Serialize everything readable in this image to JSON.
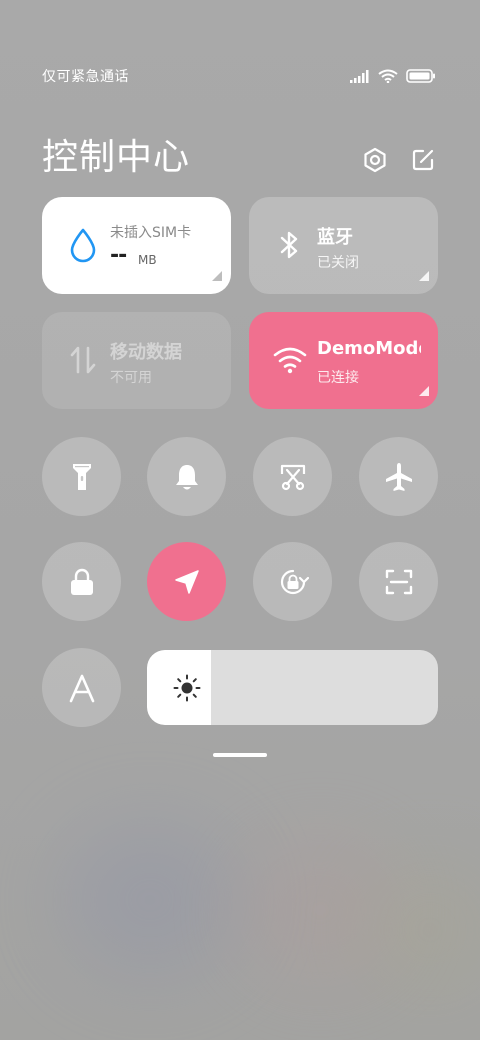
{
  "status_bar": {
    "carrier_text": "仅可紧急通话",
    "icons": [
      "signal-icon",
      "wifi-icon",
      "battery-icon"
    ]
  },
  "header": {
    "title": "控制中心",
    "icons": [
      "settings-icon",
      "edit-icon"
    ]
  },
  "tiles": {
    "data_usage": {
      "label": "未插入SIM卡",
      "value": "--",
      "unit": "MB",
      "icon": "water-drop-icon"
    },
    "bluetooth": {
      "title": "蓝牙",
      "status": "已关闭",
      "icon": "bluetooth-icon"
    },
    "mobile_data": {
      "title": "移动数据",
      "status": "不可用",
      "icon": "mobile-data-icon"
    },
    "wifi": {
      "title": "DemoMode",
      "status": "已连接",
      "icon": "wifi-icon"
    }
  },
  "toggles": [
    {
      "name": "flashlight",
      "icon": "flashlight-icon",
      "active": false
    },
    {
      "name": "mute",
      "icon": "bell-icon",
      "active": false
    },
    {
      "name": "screenshot",
      "icon": "screenshot-icon",
      "active": false
    },
    {
      "name": "airplane-mode",
      "icon": "airplane-icon",
      "active": false
    },
    {
      "name": "lock-screen",
      "icon": "lock-icon",
      "active": false
    },
    {
      "name": "location",
      "icon": "location-arrow-icon",
      "active": true
    },
    {
      "name": "rotation-lock",
      "icon": "rotation-lock-icon",
      "active": false
    },
    {
      "name": "scanner",
      "icon": "scan-icon",
      "active": false
    },
    {
      "name": "auto-brightness",
      "icon": "auto-brightness-a-icon",
      "active": false
    }
  ],
  "brightness": {
    "icon": "sun-icon",
    "level": 0.22
  },
  "colors": {
    "accent": "#f0708f",
    "data_drop": "#2196f3"
  }
}
